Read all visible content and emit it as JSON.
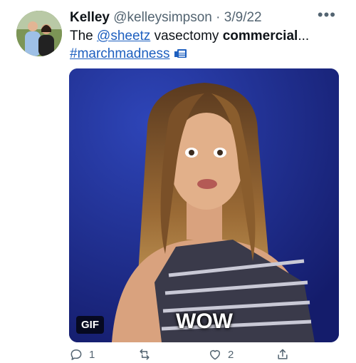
{
  "tweet": {
    "author_name": "Kelley",
    "handle": "@kelleysimpson",
    "separator": "·",
    "date": "3/9/22",
    "more_label": "•••",
    "text": {
      "prefix": "The ",
      "mention": "@sheetz",
      "middle": " vasectomy ",
      "bold": "commercial",
      "ellipsis": "...",
      "hashtag": "#marchmadness"
    }
  },
  "media": {
    "badge": "GIF",
    "caption": "WOW"
  },
  "actions": {
    "reply_count": "1",
    "like_count": "2"
  },
  "colors": {
    "accent_link": "#1d5fbf",
    "muted": "#536471",
    "media_bg": "#1f2f8c"
  }
}
